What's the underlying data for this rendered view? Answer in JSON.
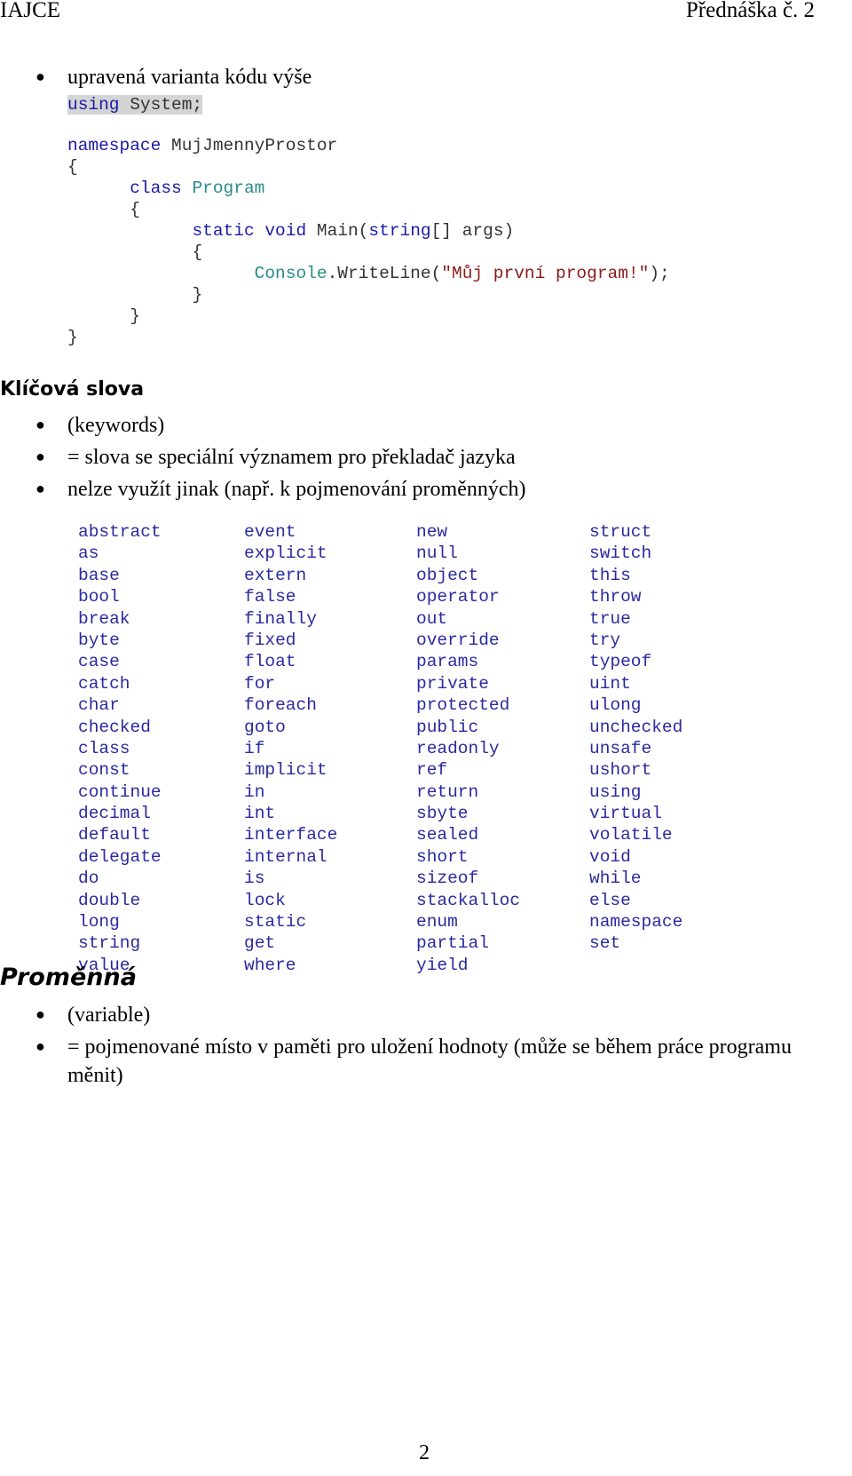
{
  "header": {
    "left": "IAJCE",
    "right": "Přednáška č. 2"
  },
  "intro_bullet": "upravená varianta kódu výše",
  "code": {
    "line1": {
      "kw": "using",
      "rest": " System;"
    },
    "line2": {
      "kw": "namespace",
      "rest": " MujJmennyProstor"
    },
    "brace_open": "{",
    "line4": {
      "kw": "class",
      "type": "Program"
    },
    "line6": {
      "kw1": "static",
      "kw2": "void",
      "mid": " Main(",
      "kw3": "string",
      "rest": "[] args)"
    },
    "line8": {
      "type": "Console",
      "mid": ".WriteLine(",
      "str": "\"Můj první program!\"",
      "rest": ");"
    },
    "brace_close": "}"
  },
  "keywords_section": {
    "heading": "Klíčová slova",
    "bullets": [
      "(keywords)",
      "= slova se speciální významem pro překladač jazyka",
      "nelze využít jinak (např. k pojmenování proměnných)"
    ],
    "table": [
      [
        "abstract",
        "event",
        "new",
        "struct"
      ],
      [
        "as",
        "explicit",
        "null",
        "switch"
      ],
      [
        "base",
        "extern",
        "object",
        "this"
      ],
      [
        "bool",
        "false",
        "operator",
        "throw"
      ],
      [
        "break",
        "finally",
        "out",
        "true"
      ],
      [
        "byte",
        "fixed",
        "override",
        "try"
      ],
      [
        "case",
        "float",
        "params",
        "typeof"
      ],
      [
        "catch",
        "for",
        "private",
        "uint"
      ],
      [
        "char",
        "foreach",
        "protected",
        "ulong"
      ],
      [
        "checked",
        "goto",
        "public",
        "unchecked"
      ],
      [
        "class",
        "if",
        "readonly",
        "unsafe"
      ],
      [
        "const",
        "implicit",
        "ref",
        "ushort"
      ],
      [
        "continue",
        "in",
        "return",
        "using"
      ],
      [
        "decimal",
        "int",
        "sbyte",
        "virtual"
      ],
      [
        "default",
        "interface",
        "sealed",
        "volatile"
      ],
      [
        "delegate",
        "internal",
        "short",
        "void"
      ],
      [
        "do",
        "is",
        "sizeof",
        "while"
      ],
      [
        "double",
        "lock",
        "stackalloc",
        "else"
      ],
      [
        "long",
        "static",
        "enum",
        "namespace"
      ],
      [
        "string",
        "get",
        "partial",
        "set"
      ],
      [
        "value",
        "where",
        "yield",
        ""
      ]
    ]
  },
  "variable_section": {
    "heading": "Proměnná",
    "bullets": [
      "(variable)",
      "= pojmenované místo v paměti pro uložení hodnoty (může se během práce programu",
      "měnit)"
    ]
  },
  "page_number": "2"
}
